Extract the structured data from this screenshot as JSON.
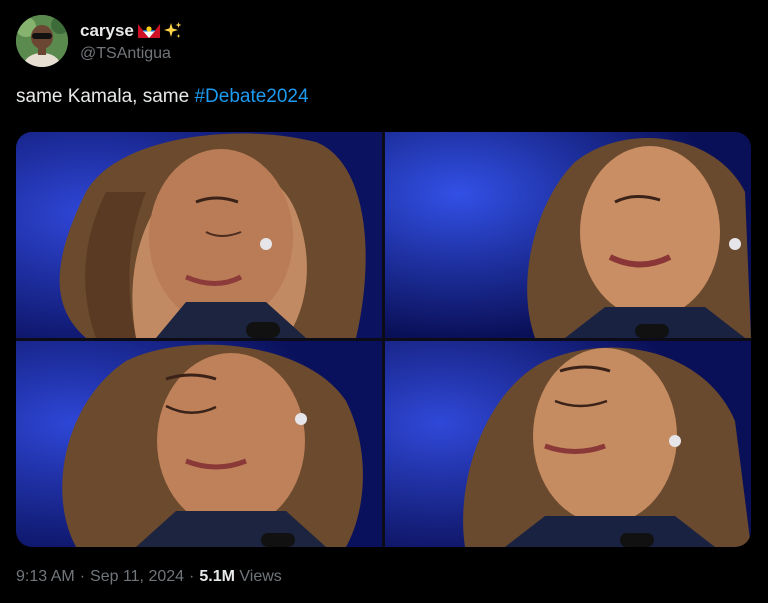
{
  "author": {
    "display_name": "caryse",
    "handle": "@TSAntigua",
    "flag_emoji": "antigua-barbuda-flag",
    "sparkle_emoji": "sparkles"
  },
  "tweet": {
    "text_prefix": "same Kamala, same ",
    "hashtag": "#Debate2024"
  },
  "media": {
    "image_count": 4,
    "alt_description": ""
  },
  "footer": {
    "time": "9:13 AM",
    "date": "Sep 11, 2024",
    "views_count": "5.1M",
    "views_label": "Views"
  },
  "colors": {
    "background": "#000000",
    "text_primary": "#e7e9ea",
    "text_secondary": "#71767b",
    "link": "#1d9bf0",
    "stage_blue": "#1a2fa8"
  }
}
